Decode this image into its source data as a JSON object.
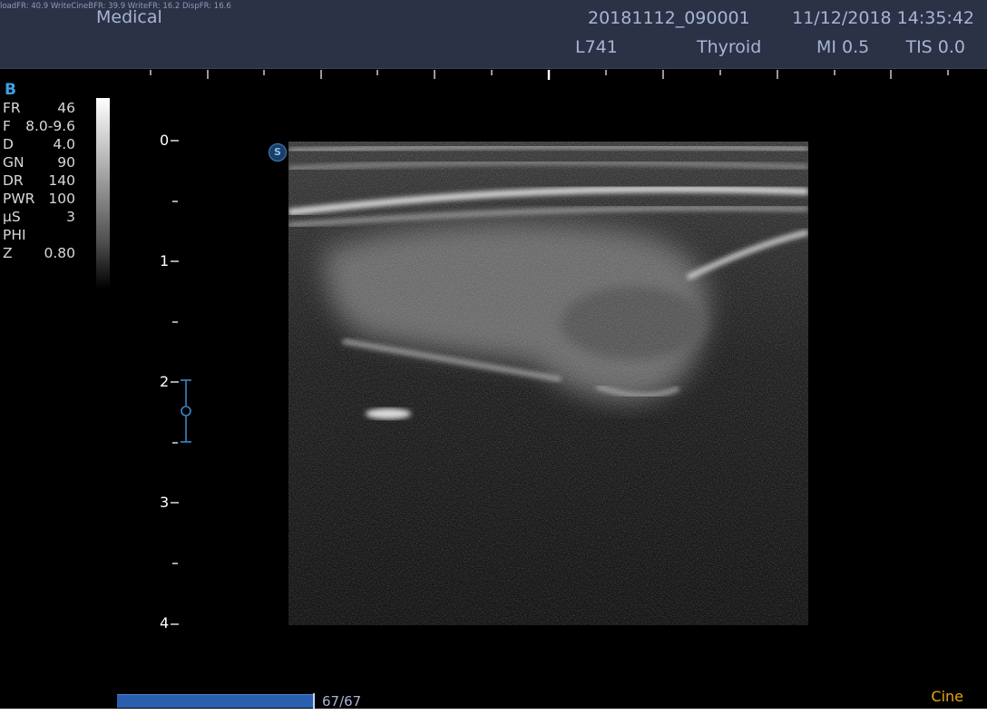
{
  "header": {
    "fps_readout": "loadFR: 40.9   WriteCineBFR: 39.9   WriteFR: 16.2   DispFR: 16.6",
    "institution": "Medical",
    "patient_id": "20181112_090001",
    "datetime": "11/12/2018 14:35:42",
    "probe": "L741",
    "preset": "Thyroid",
    "mi": "MI 0.5",
    "tis": "TIS 0.0"
  },
  "mode": "B",
  "params": [
    {
      "key": "FR",
      "value": "46"
    },
    {
      "key": "F",
      "value": "8.0-9.6"
    },
    {
      "key": "D",
      "value": "4.0"
    },
    {
      "key": "GN",
      "value": "90"
    },
    {
      "key": "DR",
      "value": "140"
    },
    {
      "key": "PWR",
      "value": "100"
    },
    {
      "key": "μS",
      "value": "3"
    },
    {
      "key": "PHI",
      "value": ""
    },
    {
      "key": "Z",
      "value": "0.80"
    }
  ],
  "depth_labels": [
    "0",
    "1",
    "2",
    "3",
    "4"
  ],
  "orientation_marker": "S",
  "cine": {
    "progress": 1.0,
    "frame_count": "67/67",
    "label": "Cine"
  },
  "colors": {
    "header_bg": "#2b3246",
    "header_text": "#a8b4d6",
    "mode_blue": "#3fa0e6",
    "cine_orange": "#e8a418",
    "cine_fill": "#2a5fb0"
  }
}
